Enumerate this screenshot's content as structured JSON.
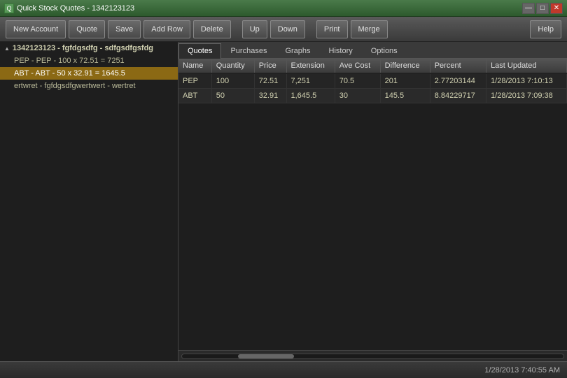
{
  "titleBar": {
    "title": "Quick Stock Quotes - 1342123123",
    "icon": "Q",
    "controls": {
      "minimize": "—",
      "maximize": "□",
      "close": "✕"
    }
  },
  "toolbar": {
    "buttons": [
      {
        "id": "new-account",
        "label": "New Account"
      },
      {
        "id": "quote",
        "label": "Quote"
      },
      {
        "id": "save",
        "label": "Save"
      },
      {
        "id": "add-row",
        "label": "Add Row"
      },
      {
        "id": "delete",
        "label": "Delete"
      },
      {
        "id": "up",
        "label": "Up"
      },
      {
        "id": "down",
        "label": "Down"
      },
      {
        "id": "print",
        "label": "Print"
      },
      {
        "id": "merge",
        "label": "Merge"
      },
      {
        "id": "help",
        "label": "Help"
      }
    ]
  },
  "tree": {
    "items": [
      {
        "id": "account-1",
        "type": "account",
        "label": "1342123123 - fgfdgsdfg - sdfgsdfgsfdg",
        "selected": false,
        "expanded": true
      },
      {
        "id": "stock-pep",
        "type": "stock",
        "label": "PEP - PEP - 100 x 72.51 = 7251",
        "selected": false
      },
      {
        "id": "stock-abt",
        "type": "stock",
        "label": "ABT - ABT - 50 x 32.91 = 1645.5",
        "selected": true
      },
      {
        "id": "stock-ertwret",
        "type": "stock",
        "label": "ertwret - fgfdgsdfgwertwert - wertret",
        "selected": false
      }
    ]
  },
  "tabs": [
    {
      "id": "quotes",
      "label": "Quotes",
      "active": true
    },
    {
      "id": "purchases",
      "label": "Purchases",
      "active": false
    },
    {
      "id": "graphs",
      "label": "Graphs",
      "active": false
    },
    {
      "id": "history",
      "label": "History",
      "active": false
    },
    {
      "id": "options",
      "label": "Options",
      "active": false
    }
  ],
  "table": {
    "columns": [
      "Name",
      "Quantity",
      "Price",
      "Extension",
      "Ave Cost",
      "Difference",
      "Percent",
      "Last Updated"
    ],
    "rows": [
      {
        "name": "PEP",
        "quantity": "100",
        "price": "72.51",
        "extension": "7,251",
        "aveCost": "70.5",
        "difference": "201",
        "percent": "2.77203144",
        "lastUpdated": "1/28/2013 7:10:13"
      },
      {
        "name": "ABT",
        "quantity": "50",
        "price": "32.91",
        "extension": "1,645.5",
        "aveCost": "30",
        "difference": "145.5",
        "percent": "8.84229717",
        "lastUpdated": "1/28/2013 7:09:38"
      }
    ]
  },
  "statusBar": {
    "timestamp": "1/28/2013 7:40:55 AM"
  }
}
